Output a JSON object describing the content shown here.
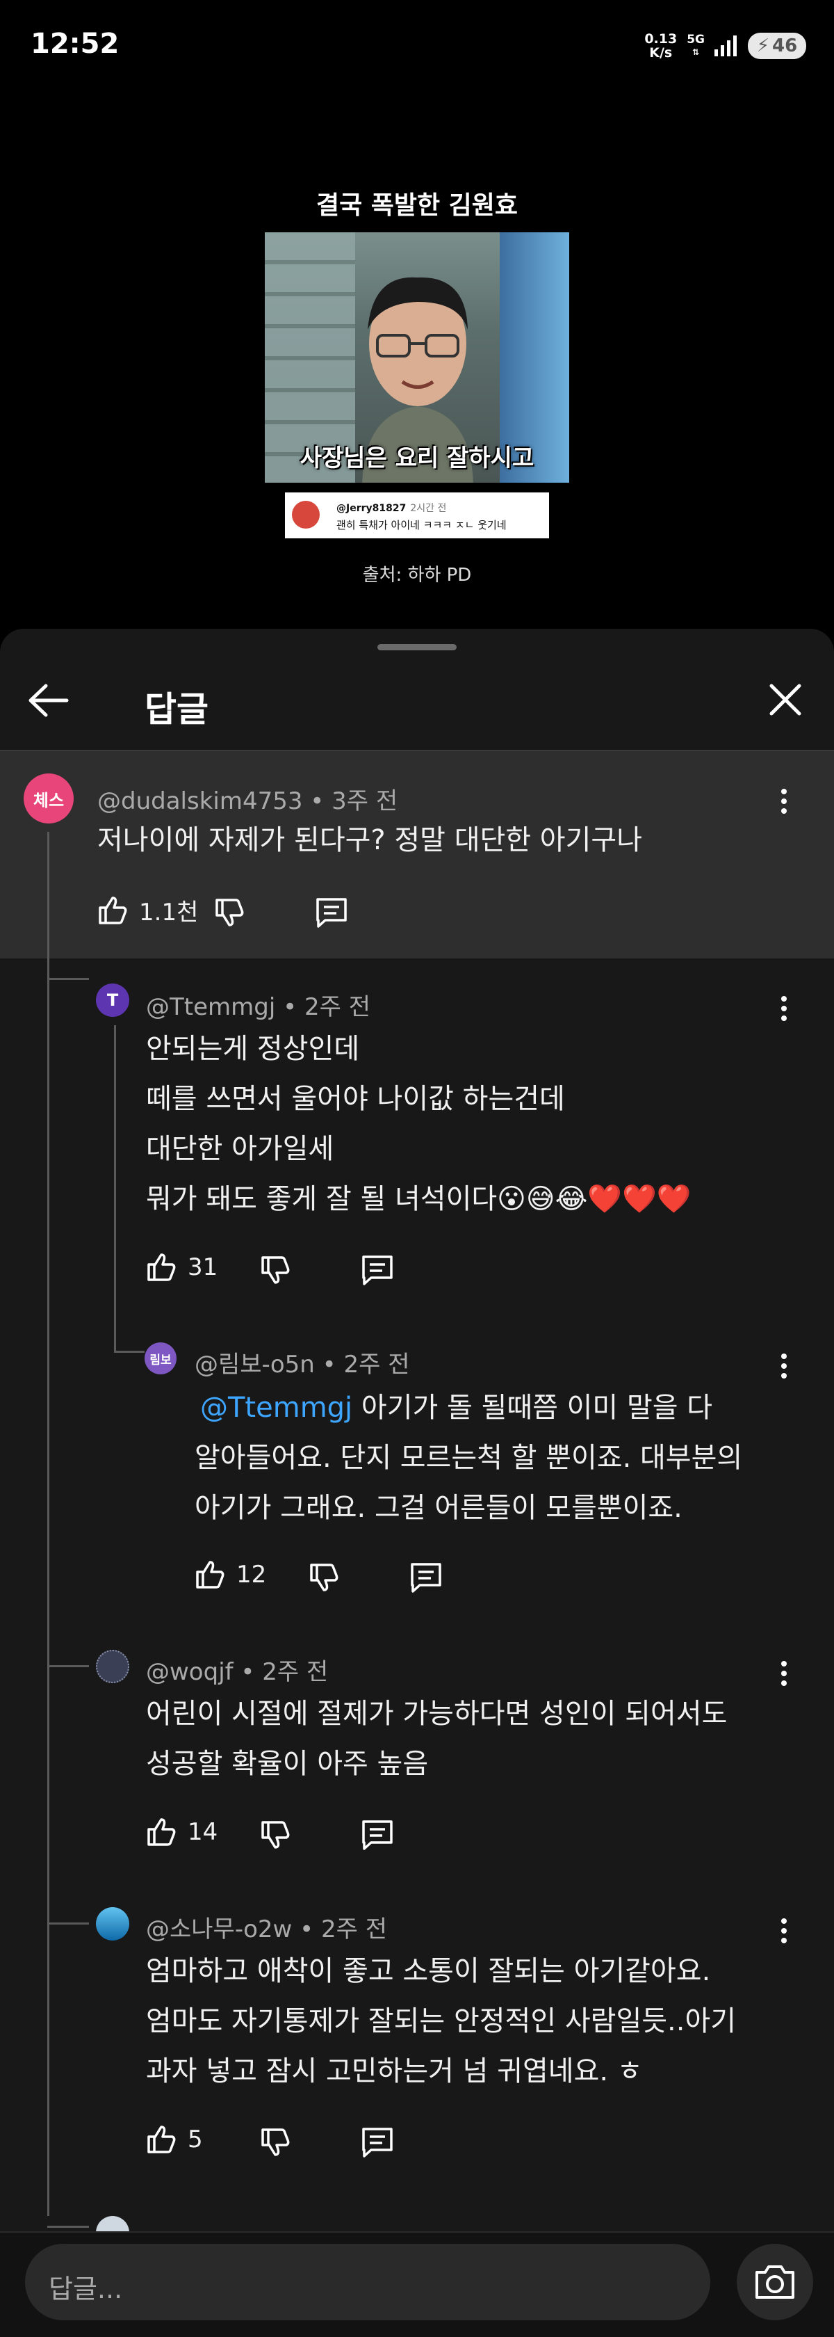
{
  "status_bar": {
    "time": "12:52",
    "net_speed_value": "0.13",
    "net_speed_unit": "K/s",
    "network": "5G",
    "battery": "46"
  },
  "video": {
    "title": "결국 폭발한 김원효",
    "thumbnail_caption": "사장님은 요리 잘하시고",
    "embedded_comment_user": "@Jerry81827",
    "embedded_comment_time": "2시간 전",
    "embedded_comment_text": "괜히 특채가 아이네 ㅋㅋㅋ ㅈㄴ 웃기네",
    "source": "출처: 하하 PD"
  },
  "panel": {
    "title": "답글"
  },
  "comments": [
    {
      "avatar_text": "체스",
      "avatar_color": "#e8457a",
      "user": "@dudalskim4753",
      "time": "3주 전",
      "lines": [
        "저나이에 자제가 된다구? 정말 대단한 아기구나"
      ],
      "likes": "1.1천"
    },
    {
      "avatar_text": "T",
      "avatar_color": "#5e35b1",
      "user": "@Ttemmgj",
      "time": "2주 전",
      "lines": [
        "안되는게 정상인데",
        "떼를 쓰면서 울어야 나이값 하는건데",
        "대단한 아가일세",
        "뭐가 돼도 좋게 잘 될 녀석이다😮😅😂❤️❤️❤️"
      ],
      "likes": "31"
    },
    {
      "avatar_text": "림보",
      "avatar_color": "#7e57c2",
      "user": "@림보-o5n",
      "time": "2주 전",
      "mention": "@Ttemmgj",
      "lines": [
        "아기가 돌 될때쯤 이미 말을 다",
        "알아들어요. 단지 모르는척 할 뿐이죠. 대부분의",
        "아기가 그래요. 그걸 어른들이 모를뿐이죠."
      ],
      "likes": "12"
    },
    {
      "avatar_text": "",
      "avatar_color": "#3a3f55",
      "user": "@woqjf",
      "time": "2주 전",
      "lines": [
        "어린이 시절에 절제가 가능하다면 성인이 되어서도",
        "성공할 확율이 아주 높음"
      ],
      "likes": "14"
    },
    {
      "avatar_text": "",
      "avatar_color": "#1e88c8",
      "user": "@소나무-o2w",
      "time": "2주 전",
      "lines": [
        "엄마하고 애착이 좋고 소통이 잘되는 아기같아요.",
        "엄마도 자기통제가 잘되는 안정적인 사람일듯..아기",
        "과자 넣고 잠시 고민하는거 넘 귀엽네요. ㅎ"
      ],
      "likes": "5"
    }
  ],
  "input": {
    "placeholder": "답글..."
  }
}
